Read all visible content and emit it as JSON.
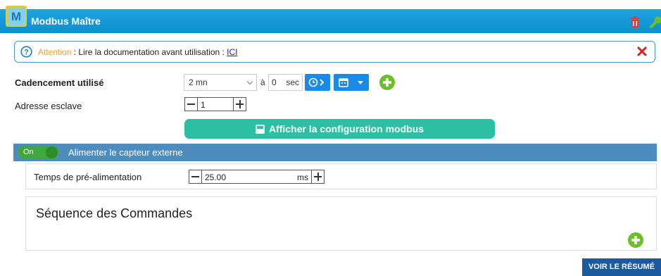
{
  "header": {
    "title": "Modbus Maître",
    "logo_letter": "M"
  },
  "alert": {
    "warning": "Attention",
    "text": " : Lire la documentation avant utilisation : ",
    "link": "ICI"
  },
  "cadencement": {
    "label": "Cadencement utilisé",
    "interval_value": "2 mn",
    "a_label": "à",
    "sec_value": "0",
    "sec_unit": "sec"
  },
  "adresse": {
    "label": "Adresse esclave",
    "value": "1"
  },
  "config_button": "Afficher la configuration modbus",
  "capteur": {
    "toggle_label": "On",
    "label": "Alimenter le capteur externe",
    "enabled": true
  },
  "pre_alimentation": {
    "label": "Temps de pré-alimentation",
    "value": "25.00",
    "unit": "ms"
  },
  "sequence": {
    "title": "Séquence des Commandes"
  },
  "summary_button": "VOIR LE RÉSUMÉ",
  "colors": {
    "header": "#1a9bdb",
    "band": "#4e8cbd",
    "green_button": "#2bc0a3",
    "plus": "#6bbf2b",
    "summary": "#1c5aa0"
  }
}
